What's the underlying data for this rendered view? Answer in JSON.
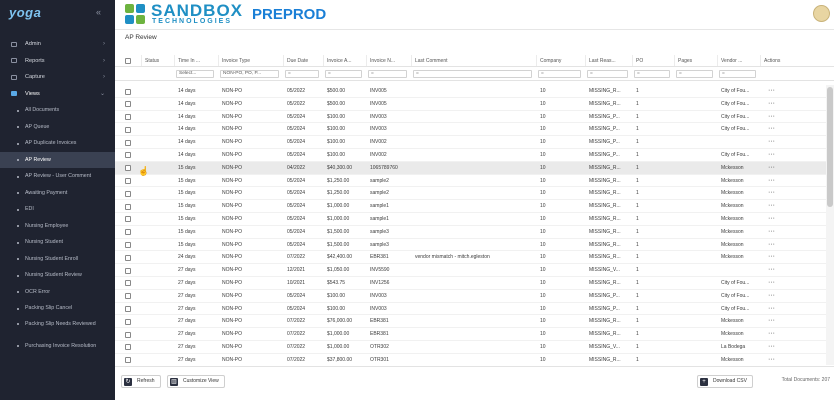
{
  "sidebar": {
    "logo": "yoga",
    "collapse_icon": "double-chevron-left-icon",
    "items": [
      {
        "label": "Admin",
        "type": "top",
        "chevron": "›"
      },
      {
        "label": "Reports",
        "type": "top",
        "chevron": "›"
      },
      {
        "label": "Capture",
        "type": "top",
        "chevron": "›"
      },
      {
        "label": "Views",
        "type": "views",
        "chevron": "⌄"
      },
      {
        "label": "All Documents",
        "type": "sub"
      },
      {
        "label": "AP Queue",
        "type": "sub"
      },
      {
        "label": "AP Duplicate Invoices",
        "type": "sub"
      },
      {
        "label": "AP Review",
        "type": "sub",
        "active": true
      },
      {
        "label": "AP Review - User Comment",
        "type": "sub"
      },
      {
        "label": "Awaiting Payment",
        "type": "sub"
      },
      {
        "label": "EDI",
        "type": "sub"
      },
      {
        "label": "Nursing Employee",
        "type": "sub"
      },
      {
        "label": "Nursing Student",
        "type": "sub"
      },
      {
        "label": "Nursing Student Enroll",
        "type": "sub"
      },
      {
        "label": "Nursing Student Review",
        "type": "sub"
      },
      {
        "label": "OCR Error",
        "type": "sub"
      },
      {
        "label": "Packing Slip Cancel",
        "type": "sub"
      },
      {
        "label": "Packing Slip Needs Reviewed",
        "type": "sub",
        "two": true
      },
      {
        "label": "Purchasing Invoice Resolution",
        "type": "sub",
        "two": true
      }
    ]
  },
  "header": {
    "brand_name": "SANDBOX",
    "brand_sub": "TECHNOLOGIES",
    "environment": "PREPROD"
  },
  "page": {
    "title": "AP Review"
  },
  "columns": [
    "",
    "Status",
    "Time In ...",
    "Invoice Type",
    "Due Date",
    "Invoice A...",
    "Invoice N...",
    "Last Comment",
    "Company",
    "Last Reas...",
    "PO",
    "Pages",
    "Vendor ...",
    "Actions"
  ],
  "filters": {
    "time_in": "Select...",
    "invoice_type": "NON-PO, PO, P...",
    "due_date": "=",
    "invoice_amount": "=",
    "invoice_number": "=",
    "last_comment": "=",
    "company": "=",
    "last_reason": "=",
    "po": "=",
    "pages": "=",
    "vendor": "="
  },
  "rows": [
    {
      "time": "14 days",
      "type": "NON-PO",
      "due": "05/2022",
      "amount": "$500.00",
      "invoice": "INV005",
      "comment": "",
      "company": "10",
      "reason": "MISSING_R...",
      "po": "1",
      "vendor": "City of Fou..."
    },
    {
      "time": "14 days",
      "type": "NON-PO",
      "due": "05/2022",
      "amount": "$500.00",
      "invoice": "INV005",
      "comment": "",
      "company": "10",
      "reason": "MISSING_R...",
      "po": "1",
      "vendor": "City of Fou..."
    },
    {
      "time": "14 days",
      "type": "NON-PO",
      "due": "05/2024",
      "amount": "$100.00",
      "invoice": "INV003",
      "comment": "",
      "company": "10",
      "reason": "MISSING_P...",
      "po": "1",
      "vendor": "City of Fou..."
    },
    {
      "time": "14 days",
      "type": "NON-PO",
      "due": "05/2024",
      "amount": "$100.00",
      "invoice": "INV003",
      "comment": "",
      "company": "10",
      "reason": "MISSING_P...",
      "po": "1",
      "vendor": "City of Fou..."
    },
    {
      "time": "14 days",
      "type": "NON-PO",
      "due": "05/2024",
      "amount": "$100.00",
      "invoice": "INV002",
      "comment": "",
      "company": "10",
      "reason": "MISSING_P...",
      "po": "1",
      "vendor": ""
    },
    {
      "time": "14 days",
      "type": "NON-PO",
      "due": "05/2024",
      "amount": "$100.00",
      "invoice": "INV002",
      "comment": "",
      "company": "10",
      "reason": "MISSING_P...",
      "po": "1",
      "vendor": "City of Fou..."
    },
    {
      "time": "15 days",
      "type": "NON-PO",
      "due": "04/2022",
      "amount": "$40,300.00",
      "invoice": "1065789760",
      "comment": "",
      "company": "10",
      "reason": "MISSING_R...",
      "po": "1",
      "vendor": "Mckesson",
      "hl": true
    },
    {
      "time": "15 days",
      "type": "NON-PO",
      "due": "05/2024",
      "amount": "$1,250.00",
      "invoice": "sample2",
      "comment": "",
      "company": "10",
      "reason": "MISSING_R...",
      "po": "1",
      "vendor": "Mckesson"
    },
    {
      "time": "15 days",
      "type": "NON-PO",
      "due": "05/2024",
      "amount": "$1,250.00",
      "invoice": "sample2",
      "comment": "",
      "company": "10",
      "reason": "MISSING_R...",
      "po": "1",
      "vendor": "Mckesson"
    },
    {
      "time": "15 days",
      "type": "NON-PO",
      "due": "05/2024",
      "amount": "$1,000.00",
      "invoice": "sample1",
      "comment": "",
      "company": "10",
      "reason": "MISSING_R...",
      "po": "1",
      "vendor": "Mckesson"
    },
    {
      "time": "15 days",
      "type": "NON-PO",
      "due": "05/2024",
      "amount": "$1,000.00",
      "invoice": "sample1",
      "comment": "",
      "company": "10",
      "reason": "MISSING_R...",
      "po": "1",
      "vendor": "Mckesson"
    },
    {
      "time": "15 days",
      "type": "NON-PO",
      "due": "05/2024",
      "amount": "$1,500.00",
      "invoice": "sample3",
      "comment": "",
      "company": "10",
      "reason": "MISSING_R...",
      "po": "1",
      "vendor": "Mckesson"
    },
    {
      "time": "15 days",
      "type": "NON-PO",
      "due": "05/2024",
      "amount": "$1,500.00",
      "invoice": "sample3",
      "comment": "",
      "company": "10",
      "reason": "MISSING_R...",
      "po": "1",
      "vendor": "Mckesson"
    },
    {
      "time": "24 days",
      "type": "NON-PO",
      "due": "07/2022",
      "amount": "$42,400.00",
      "invoice": "EBR381",
      "comment": "vendor mismatch - mitch.egleston",
      "company": "10",
      "reason": "MISSING_R...",
      "po": "1",
      "vendor": "Mckesson"
    },
    {
      "time": "27 days",
      "type": "NON-PO",
      "due": "12/2021",
      "amount": "$1,050.00",
      "invoice": "INV5590",
      "comment": "",
      "company": "10",
      "reason": "MISSING_V...",
      "po": "1",
      "vendor": ""
    },
    {
      "time": "27 days",
      "type": "NON-PO",
      "due": "10/2021",
      "amount": "$543.75",
      "invoice": "INV1256",
      "comment": "",
      "company": "10",
      "reason": "MISSING_R...",
      "po": "1",
      "vendor": "City of Fou..."
    },
    {
      "time": "27 days",
      "type": "NON-PO",
      "due": "05/2024",
      "amount": "$100.00",
      "invoice": "INV003",
      "comment": "",
      "company": "10",
      "reason": "MISSING_P...",
      "po": "1",
      "vendor": "City of Fou..."
    },
    {
      "time": "27 days",
      "type": "NON-PO",
      "due": "05/2024",
      "amount": "$100.00",
      "invoice": "INV003",
      "comment": "",
      "company": "10",
      "reason": "MISSING_P...",
      "po": "1",
      "vendor": "City of Fou..."
    },
    {
      "time": "27 days",
      "type": "NON-PO",
      "due": "07/2022",
      "amount": "$76,000.00",
      "invoice": "EBR381",
      "comment": "",
      "company": "10",
      "reason": "MISSING_R...",
      "po": "1",
      "vendor": "Mckesson"
    },
    {
      "time": "27 days",
      "type": "NON-PO",
      "due": "07/2022",
      "amount": "$1,000.00",
      "invoice": "EBR381",
      "comment": "",
      "company": "10",
      "reason": "MISSING_R...",
      "po": "1",
      "vendor": "Mckesson"
    },
    {
      "time": "27 days",
      "type": "NON-PO",
      "due": "07/2022",
      "amount": "$1,000.00",
      "invoice": "OTR302",
      "comment": "",
      "company": "10",
      "reason": "MISSING_V...",
      "po": "1",
      "vendor": "La Bodega"
    },
    {
      "time": "27 days",
      "type": "NON-PO",
      "due": "07/2022",
      "amount": "$37,800.00",
      "invoice": "OTR301",
      "comment": "",
      "company": "10",
      "reason": "MISSING_R...",
      "po": "1",
      "vendor": "Mckesson"
    },
    {
      "time": "27 days",
      "type": "NON-PO",
      "due": "",
      "amount": "",
      "invoice": "",
      "comment": "",
      "company": "",
      "reason": "ZERO_DOLL...",
      "po": "1",
      "vendor": ""
    }
  ],
  "footer": {
    "refresh": "Refresh",
    "customize": "Customize View",
    "download": "Download CSV",
    "total": "Total Documents: 207"
  }
}
